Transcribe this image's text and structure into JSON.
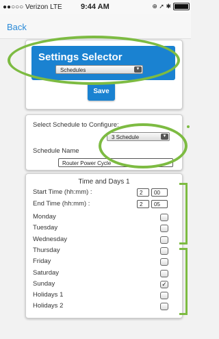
{
  "status_bar": {
    "carrier": "●●○○○ Verizon  LTE",
    "time": "9:44 AM",
    "icons": "⊕ ➚ ✱"
  },
  "nav": {
    "back_label": "Back"
  },
  "settings": {
    "title": "Settings Selector",
    "selected": "Schedules",
    "save_label": "Save"
  },
  "schedule": {
    "select_label": "Select Schedule to Configure:",
    "selected": "3 Schedule",
    "name_label": "Schedule Name",
    "name_value": "Router Power Cycle"
  },
  "times": {
    "title": "Time and Days 1",
    "start_label": "Start Time (hh:mm) :",
    "start_hh": "2",
    "start_mm": "00",
    "end_label": "End Time (hh:mm) :",
    "end_hh": "2",
    "end_mm": "05"
  },
  "days": [
    {
      "label": "Monday",
      "checked": false
    },
    {
      "label": "Tuesday",
      "checked": false
    },
    {
      "label": "Wednesday",
      "checked": false
    },
    {
      "label": "Thursday",
      "checked": false
    },
    {
      "label": "Friday",
      "checked": false
    },
    {
      "label": "Saturday",
      "checked": false
    },
    {
      "label": "Sunday",
      "checked": true
    },
    {
      "label": "Holidays 1",
      "checked": false
    },
    {
      "label": "Holidays 2",
      "checked": false
    }
  ],
  "colors": {
    "accent": "#1a82d1",
    "highlight": "#7dbb42"
  }
}
